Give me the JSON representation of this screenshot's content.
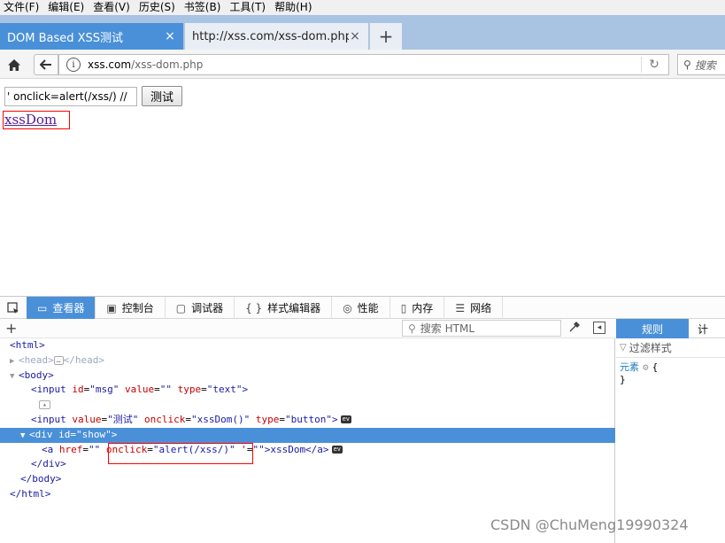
{
  "menu": [
    "文件(F)",
    "编辑(E)",
    "查看(V)",
    "历史(S)",
    "书签(B)",
    "工具(T)",
    "帮助(H)"
  ],
  "tabs": [
    {
      "label": "DOM Based XSS测试",
      "close": "×"
    },
    {
      "label": "http://xss.com/xss-dom.php",
      "close": "×"
    }
  ],
  "new_tab": "+",
  "url": {
    "host": "xss.com",
    "path": "/xss-dom.php"
  },
  "search_placeholder": "搜索",
  "page": {
    "input_value": "' onclick=alert(/xss/) //",
    "button_label": "测试",
    "link_text": "xssDom"
  },
  "devtools": {
    "tabs": [
      {
        "icon": "▭",
        "label": "查看器"
      },
      {
        "icon": "▣",
        "label": "控制台"
      },
      {
        "icon": "▢",
        "label": "调试器"
      },
      {
        "icon": "{ }",
        "label": "样式编辑器"
      },
      {
        "icon": "◎",
        "label": "性能"
      },
      {
        "icon": "▯",
        "label": "内存"
      },
      {
        "icon": "☰",
        "label": "网络"
      }
    ],
    "search_html_placeholder": "搜索 HTML",
    "markup": {
      "html_open": "<html>",
      "head_open": "<head>",
      "head_ellipsis": "…",
      "head_close": "</head>",
      "body_open": "<body>",
      "input1": {
        "tag": "<input",
        "a1": "id",
        "v1": "\"msg\"",
        "a2": "value",
        "v2": "\"\"",
        "a3": "type",
        "v3": "\"text\"",
        "end": ">"
      },
      "input2": {
        "tag": "<input",
        "a1": "value",
        "v1": "\"测试\"",
        "a2": "onclick",
        "v2": "\"xssDom()\"",
        "a3": "type",
        "v3": "\"button\"",
        "end": ">",
        "ev": "ev"
      },
      "div": {
        "tag": "<div",
        "a1": "id",
        "v1": "\"show\"",
        "end": ">"
      },
      "a": {
        "tag": "<a",
        "a1": "href",
        "v1": "\"\"",
        "a2": "onclick",
        "v2": "\"alert(/xss/)\"",
        "a3": "'",
        "v3": "\"\"",
        "text": ">xssDom</a>",
        "ev": "ev"
      },
      "div_close": "</div>",
      "body_close": "</body>",
      "html_close": "</html>"
    },
    "rules": {
      "tab_rules": "规则",
      "tab_computed": "计",
      "filter_placeholder": "过滤样式",
      "element_selector": "元素",
      "brace_open": "{",
      "brace_close": "}"
    }
  },
  "watermark": "CSDN @ChuMeng19990324"
}
